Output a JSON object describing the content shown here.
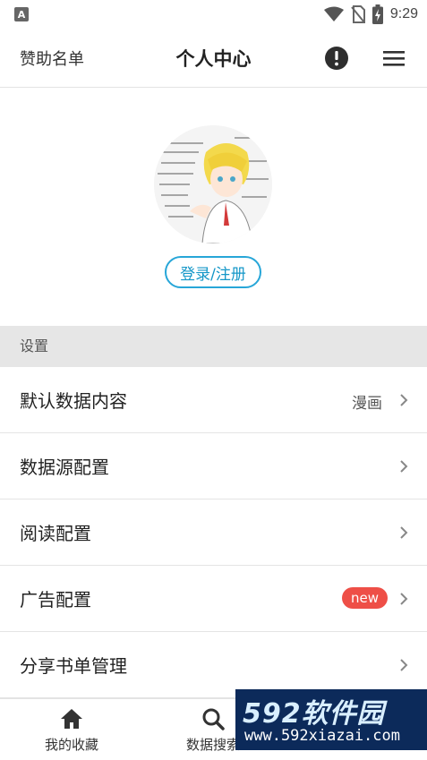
{
  "status_bar": {
    "notification_icon": "A",
    "time": "9:29",
    "icons": [
      "wifi-icon",
      "no-sim-icon",
      "battery-charging-icon"
    ]
  },
  "header": {
    "left_label": "赞助名单",
    "title": "个人中心",
    "icons": [
      "info-icon",
      "menu-icon"
    ]
  },
  "profile": {
    "login_label": "登录/注册"
  },
  "settings": {
    "section_title": "设置",
    "items": [
      {
        "label": "默认数据内容",
        "value": "漫画"
      },
      {
        "label": "数据源配置"
      },
      {
        "label": "阅读配置"
      },
      {
        "label": "广告配置",
        "badge": "new"
      },
      {
        "label": "分享书单管理"
      }
    ]
  },
  "bottom_nav": {
    "items": [
      {
        "label": "我的收藏",
        "icon": "home-icon"
      },
      {
        "label": "数据搜索",
        "icon": "search-icon"
      }
    ]
  },
  "watermark": {
    "title": "592软件园",
    "url": "www.592xiazai.com"
  },
  "colors": {
    "accent": "#27a6d8",
    "badge": "#ee4f47",
    "section_bg": "#e6e6e6"
  }
}
